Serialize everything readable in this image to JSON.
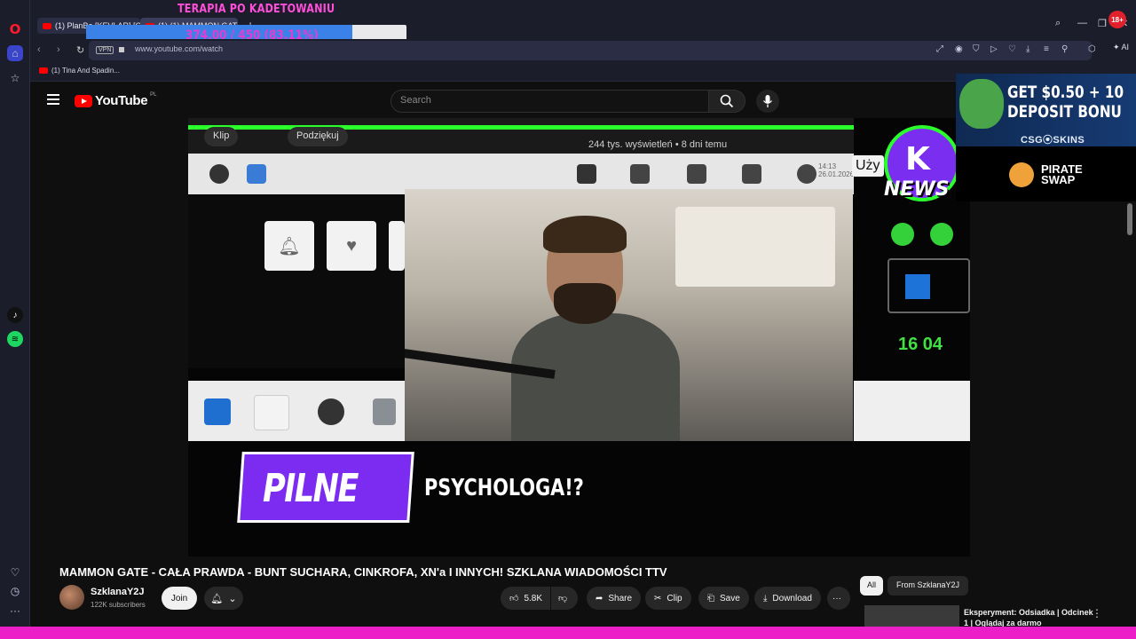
{
  "overlay": {
    "title": "TERAPIA PO KADETOWANIU",
    "progress_text": "374.00 / 450 (83.11%)",
    "progress_fraction": 0.8311,
    "accent": "#e23dd0",
    "bar_color": "#3a82e8"
  },
  "browser": {
    "tabs": [
      {
        "label": "(1) PlanBe [KEVLAR] [OFI..."
      },
      {
        "label": "(1) (1) MAMMON GATE ..."
      }
    ],
    "address": {
      "vpn": "VPN",
      "url": "www.youtube.com/watch"
    },
    "bookmark": "(1) Tina And Spadin...",
    "ai_label": "AI",
    "age_badge": "18+",
    "rail_icons": [
      "opera-icon",
      "home-icon",
      "star-icon",
      "tiktok-icon",
      "spotify-icon",
      "heart-icon",
      "clock-icon",
      "more-icon"
    ]
  },
  "youtube": {
    "logo": "YouTube",
    "logo_region": "PL",
    "search_placeholder": "Search",
    "video": {
      "title": "MAMMON GATE - CAŁA PRAWDA - BUNT SUCHARA, CINKROFA, XN'a I INNYCH! SZKLANA WIADOMOŚCI TTV",
      "channel": "SzklanaY2J",
      "subscribers": "122K subscribers",
      "join": "Join",
      "likes": "5.8K",
      "share": "Share",
      "clip": "Clip",
      "save": "Save",
      "download": "Download"
    },
    "player": {
      "btn_clip": "Klip",
      "btn_thanks": "Podziękuj",
      "meta": "244 tys. wyświetleń • 8 dni temu",
      "clock_time": "14:13",
      "clock_date": "26.01.2026",
      "uzy": "Uży",
      "news": "NEWS",
      "count": "16 04",
      "pilne": "PILNE",
      "caption": "PSYCHOLOGA!?"
    },
    "filters": {
      "all": "All",
      "from": "From SzklanaY2J"
    },
    "recommendation": {
      "title": "Eksperyment: Odsiadka | Odcinek 1 | Oglądaj za darmo"
    }
  },
  "ads": {
    "csg": {
      "line1": "GET $0.50 + 10",
      "line2": "DEPOSIT BONU",
      "brand": "CSG⦿SKINS"
    },
    "pirate": {
      "line1": "PIRATE",
      "line2": "SWAP"
    }
  }
}
